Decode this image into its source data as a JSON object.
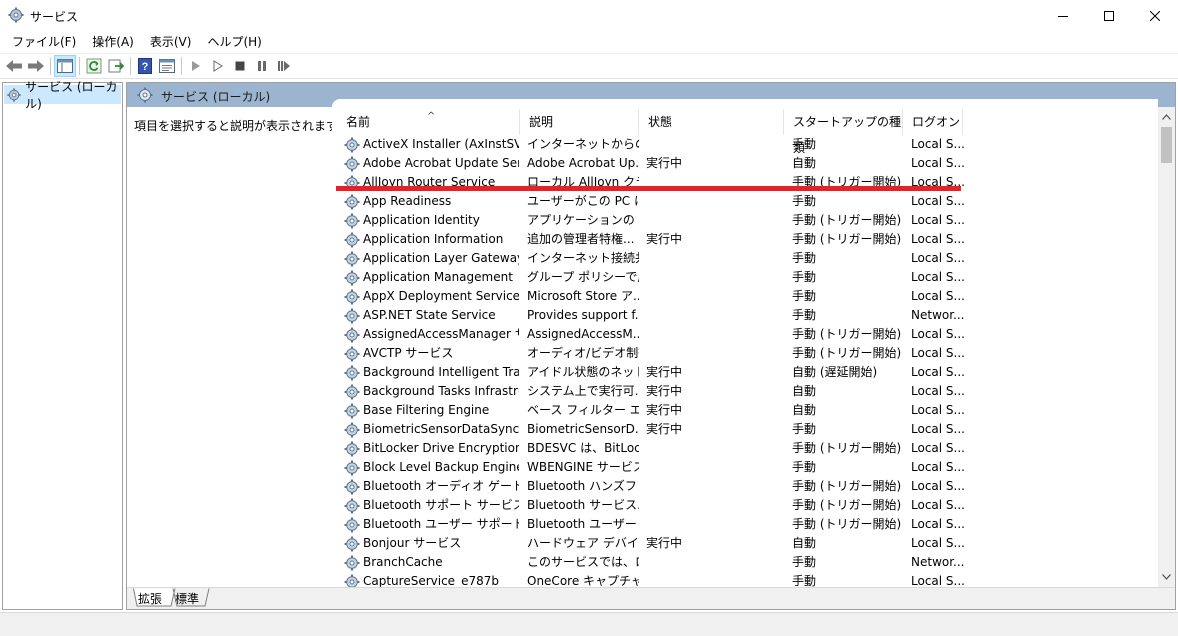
{
  "window": {
    "title": "サービス",
    "controls": {
      "minimize": "minimize",
      "maximize": "maximize",
      "close": "close"
    }
  },
  "menu": [
    "ファイル(F)",
    "操作(A)",
    "表示(V)",
    "ヘルプ(H)"
  ],
  "tree": {
    "item": "サービス (ローカル)"
  },
  "panel": {
    "title": "サービス (ローカル)",
    "description": "項目を選択すると説明が表示されます。"
  },
  "columns": {
    "name": "名前",
    "description": "説明",
    "status": "状態",
    "startup": "スタートアップの種類",
    "logon": "ログオン"
  },
  "services": [
    {
      "name": "ActiveX Installer (AxInstSV)",
      "desc": "インターネットからの ...",
      "status": "",
      "startup": "手動",
      "logon": "Local S..."
    },
    {
      "name": "Adobe Acrobat Update Serv...",
      "desc": "Adobe Acrobat Up...",
      "status": "実行中",
      "startup": "自動",
      "logon": "Local S..."
    },
    {
      "name": "AllJoyn Router Service",
      "desc": "ローカル AllJoyn クラ...",
      "status": "",
      "startup": "手動 (トリガー開始)",
      "logon": "Local S..."
    },
    {
      "name": "App Readiness",
      "desc": "ユーザーがこの PC に...",
      "status": "",
      "startup": "手動",
      "logon": "Local S..."
    },
    {
      "name": "Application Identity",
      "desc": "アプリケーションの ID ...",
      "status": "",
      "startup": "手動 (トリガー開始)",
      "logon": "Local S..."
    },
    {
      "name": "Application Information",
      "desc": "追加の管理者特権...",
      "status": "実行中",
      "startup": "手動 (トリガー開始)",
      "logon": "Local S..."
    },
    {
      "name": "Application Layer Gateway ...",
      "desc": "インターネット接続共...",
      "status": "",
      "startup": "手動",
      "logon": "Local S..."
    },
    {
      "name": "Application Management",
      "desc": "グループ ポリシーで展...",
      "status": "",
      "startup": "手動",
      "logon": "Local S..."
    },
    {
      "name": "AppX Deployment Service (...",
      "desc": "Microsoft Store ア...",
      "status": "",
      "startup": "手動",
      "logon": "Local S..."
    },
    {
      "name": "ASP.NET State Service",
      "desc": "Provides support f...",
      "status": "",
      "startup": "手動",
      "logon": "Networ..."
    },
    {
      "name": "AssignedAccessManager サ...",
      "desc": "AssignedAccessM...",
      "status": "",
      "startup": "手動 (トリガー開始)",
      "logon": "Local S..."
    },
    {
      "name": "AVCTP サービス",
      "desc": "オーディオ/ビデオ制御...",
      "status": "",
      "startup": "手動 (トリガー開始)",
      "logon": "Local S..."
    },
    {
      "name": "Background Intelligent Tran...",
      "desc": "アイドル状態のネット...",
      "status": "実行中",
      "startup": "自動 (遅延開始)",
      "logon": "Local S..."
    },
    {
      "name": "Background Tasks Infrastruc...",
      "desc": "システム上で実行可...",
      "status": "実行中",
      "startup": "自動",
      "logon": "Local S..."
    },
    {
      "name": "Base Filtering Engine",
      "desc": "ベース フィルター エン...",
      "status": "実行中",
      "startup": "自動",
      "logon": "Local S..."
    },
    {
      "name": "BiometricSensorDataSynchr...",
      "desc": "BiometricSensorD...",
      "status": "実行中",
      "startup": "手動",
      "logon": "Local S..."
    },
    {
      "name": "BitLocker Drive Encryption ...",
      "desc": "BDESVC は、BitLoc...",
      "status": "",
      "startup": "手動 (トリガー開始)",
      "logon": "Local S..."
    },
    {
      "name": "Block Level Backup Engine ...",
      "desc": "WBENGINE サービス...",
      "status": "",
      "startup": "手動",
      "logon": "Local S..."
    },
    {
      "name": "Bluetooth オーディオ ゲートウェ...",
      "desc": "Bluetooth ハンズフリ...",
      "status": "",
      "startup": "手動 (トリガー開始)",
      "logon": "Local S..."
    },
    {
      "name": "Bluetooth サポート サービス",
      "desc": "Bluetooth サービス...",
      "status": "",
      "startup": "手動 (トリガー開始)",
      "logon": "Local S..."
    },
    {
      "name": "Bluetooth ユーザー サポート サ...",
      "desc": "Bluetooth ユーザー ...",
      "status": "",
      "startup": "手動 (トリガー開始)",
      "logon": "Local S..."
    },
    {
      "name": "Bonjour サービス",
      "desc": "ハードウェア デバイス...",
      "status": "実行中",
      "startup": "自動",
      "logon": "Local S..."
    },
    {
      "name": "BranchCache",
      "desc": "このサービスでは、ロー...",
      "status": "",
      "startup": "手動",
      "logon": "Networ..."
    },
    {
      "name": "CaptureService_e787b",
      "desc": "OneCore キャプチャ ...",
      "status": "",
      "startup": "手動",
      "logon": "Local S..."
    }
  ],
  "tabs": [
    "拡張",
    "標準"
  ],
  "colors": {
    "header": "#9bb5d0",
    "selection": "#cce8ff",
    "annotation": "#e8202a"
  }
}
